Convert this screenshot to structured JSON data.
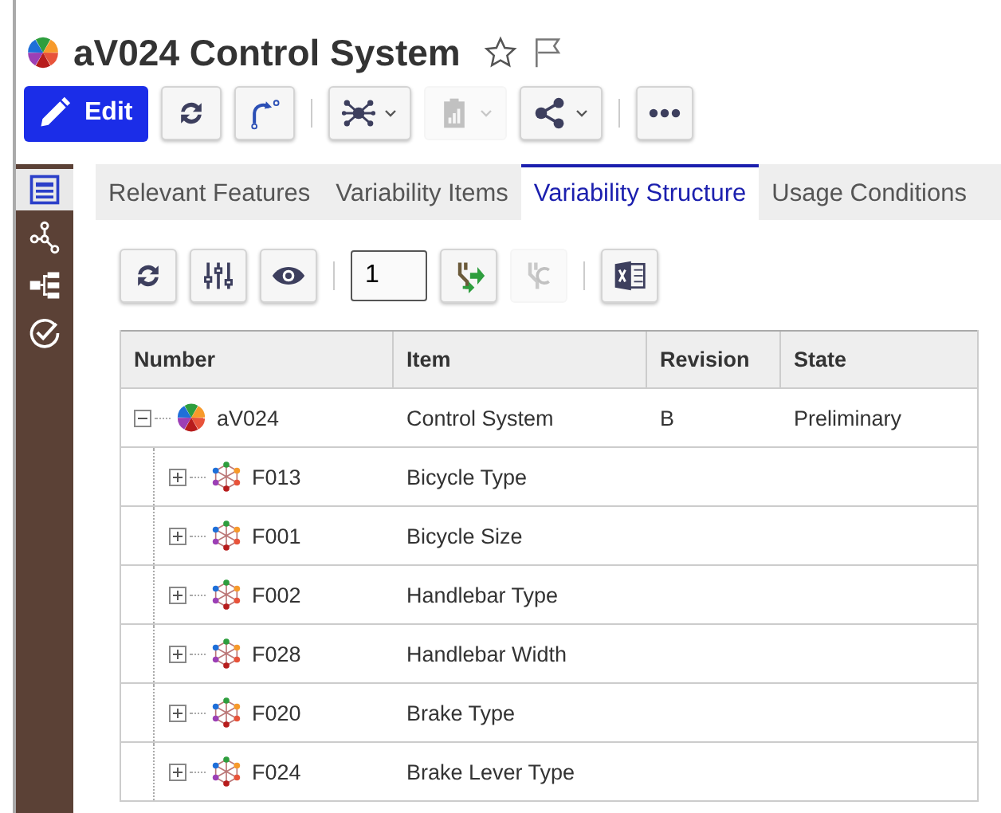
{
  "window": {
    "title": "aV024 Control System",
    "favorite": false,
    "flagged": false
  },
  "toolbar": [
    {
      "kind": "edit",
      "label": "Edit",
      "disabled": false
    },
    {
      "kind": "refresh",
      "disabled": false
    },
    {
      "kind": "revise",
      "disabled": false
    },
    {
      "kind": "separator"
    },
    {
      "kind": "network",
      "disabled": false,
      "dropdown": true
    },
    {
      "kind": "report",
      "disabled": true,
      "dropdown": true
    },
    {
      "kind": "share",
      "disabled": false,
      "dropdown": true
    },
    {
      "kind": "separator"
    },
    {
      "kind": "more",
      "disabled": false
    }
  ],
  "sidebar": {
    "items": [
      {
        "kind": "form",
        "selected": true
      },
      {
        "kind": "graph",
        "selected": false
      },
      {
        "kind": "tree",
        "selected": false
      },
      {
        "kind": "check",
        "selected": false
      }
    ]
  },
  "tabs": [
    {
      "label": "Relevant Features",
      "selected": false
    },
    {
      "label": "Variability Items",
      "selected": false
    },
    {
      "label": "Variability Structure",
      "selected": true
    },
    {
      "label": "Usage Conditions",
      "selected": false
    }
  ],
  "grid_toolbar": [
    {
      "kind": "refresh",
      "disabled": false
    },
    {
      "kind": "columns",
      "disabled": false
    },
    {
      "kind": "view",
      "disabled": false
    },
    {
      "kind": "separator"
    },
    {
      "kind": "level",
      "value": "1"
    },
    {
      "kind": "expand",
      "disabled": false
    },
    {
      "kind": "collapse",
      "disabled": true
    },
    {
      "kind": "separator"
    },
    {
      "kind": "excel",
      "disabled": false
    }
  ],
  "table": {
    "columns": [
      "Number",
      "Item",
      "Revision",
      "State"
    ],
    "rows": [
      {
        "kind": "system",
        "number": "aV024",
        "item": "Control System",
        "revision": "B",
        "state": "Preliminary",
        "expanded": true,
        "children": [
          {
            "kind": "feature",
            "number": "F013",
            "item": "Bicycle Type",
            "expanded": false
          },
          {
            "kind": "feature",
            "number": "F001",
            "item": "Bicycle Size",
            "expanded": false
          },
          {
            "kind": "feature",
            "number": "F002",
            "item": "Handlebar Type",
            "expanded": false
          },
          {
            "kind": "feature",
            "number": "F028",
            "item": "Handlebar Width",
            "expanded": false
          },
          {
            "kind": "feature",
            "number": "F020",
            "item": "Brake Type",
            "expanded": false
          },
          {
            "kind": "feature",
            "number": "F024",
            "item": "Brake Lever Type",
            "expanded": false
          }
        ]
      }
    ]
  }
}
